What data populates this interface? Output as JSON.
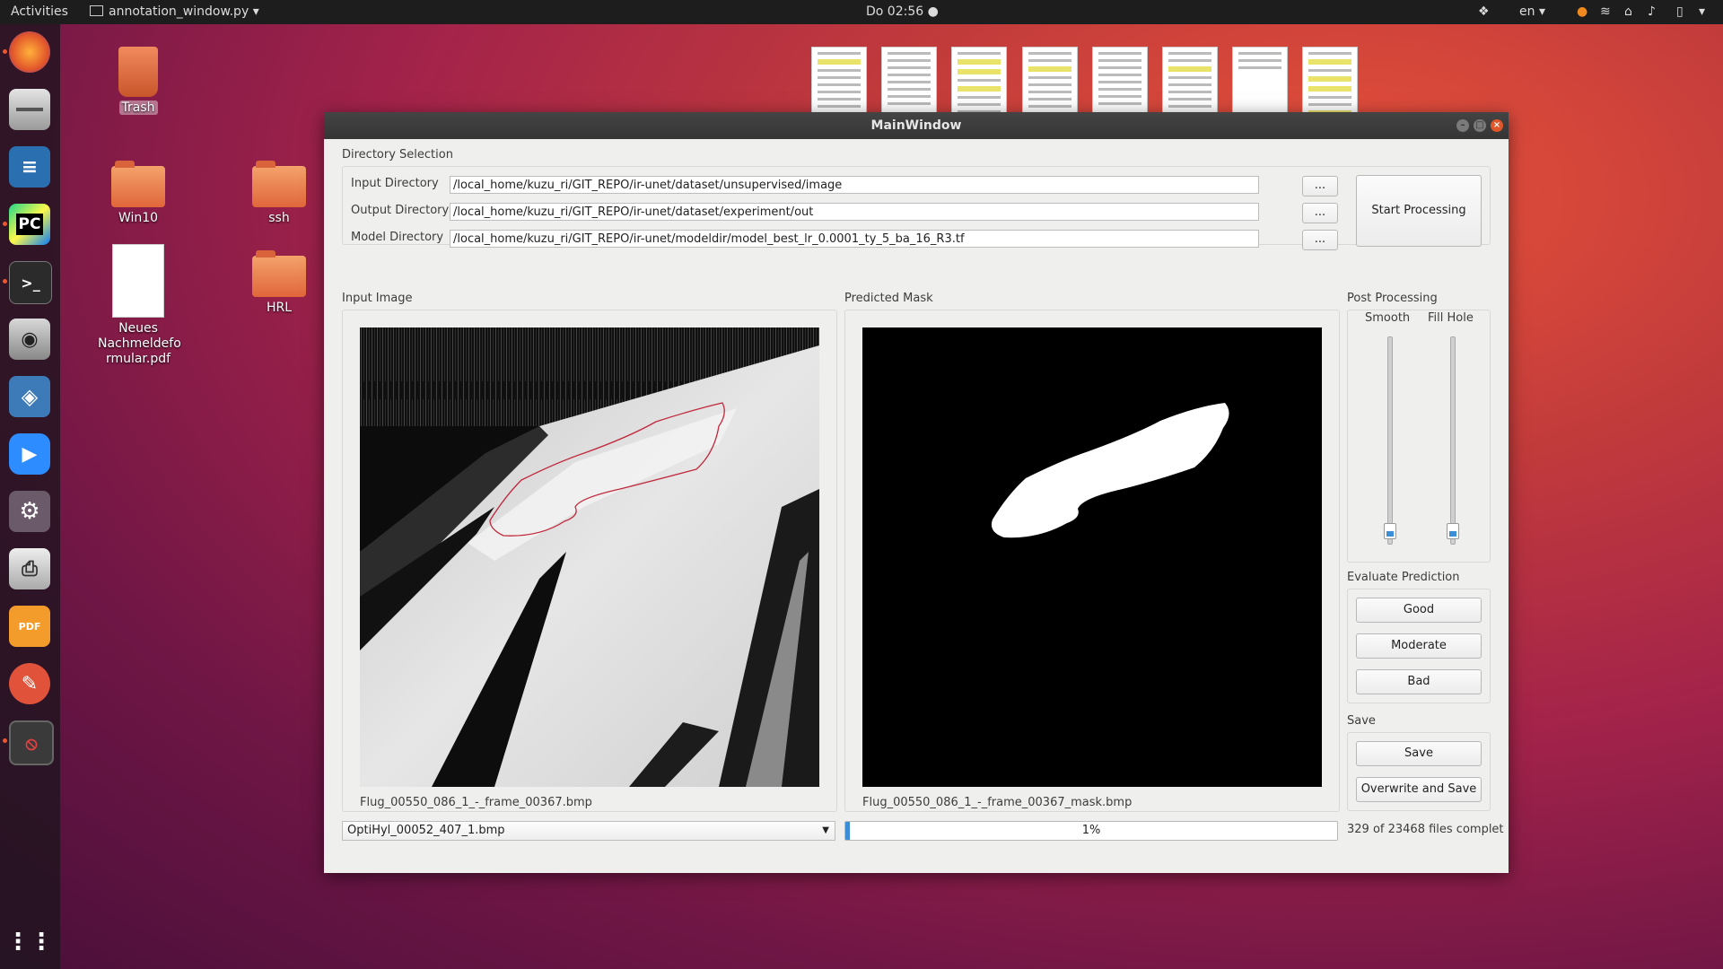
{
  "topbar": {
    "activities": "Activities",
    "app_menu": "annotation_window.py",
    "clock": "Do 02:56",
    "language": "en"
  },
  "desktop": {
    "icons": [
      {
        "label": "Trash"
      },
      {
        "label": "Win10"
      },
      {
        "label": "ssh"
      },
      {
        "label": "Neues Nachmeldefo rmular.pdf"
      },
      {
        "label": "HRL"
      }
    ]
  },
  "window": {
    "title": "MainWindow",
    "directory_selection": {
      "heading": "Directory Selection",
      "input_label": "Input Directory",
      "input_value": "/local_home/kuzu_ri/GIT_REPO/ir-unet/dataset/unsupervised/image",
      "output_label": "Output Directory",
      "output_value": "/local_home/kuzu_ri/GIT_REPO/ir-unet/dataset/experiment/out",
      "model_label": "Model Directory",
      "model_value": "/local_home/kuzu_ri/GIT_REPO/ir-unet/modeldir/model_best_lr_0.0001_ty_5_ba_16_R3.tf",
      "browse_label": "...",
      "start_label": "Start Processing"
    },
    "input_image": {
      "heading": "Input Image",
      "filename": "Flug_00550_086_1_-_frame_00367.bmp"
    },
    "predicted_mask": {
      "heading": "Predicted Mask",
      "filename": "Flug_00550_086_1_-_frame_00367_mask.bmp"
    },
    "post_processing": {
      "heading": "Post Processing",
      "smooth_label": "Smooth",
      "fill_hole_label": "Fill Hole"
    },
    "evaluate": {
      "heading": "Evaluate Prediction",
      "good": "Good",
      "moderate": "Moderate",
      "bad": "Bad"
    },
    "save": {
      "heading": "Save",
      "save": "Save",
      "overwrite": "Overwrite and Save"
    },
    "file_select": "OptiHyl_00052_407_1.bmp",
    "progress": {
      "value": 0.01,
      "text": "1%",
      "status": "329 of 23468 files complet"
    }
  },
  "colors": {
    "progress_fill": "#3b8ed6",
    "contour": "#c0283c",
    "slider_handle": "#3b8ed6"
  }
}
